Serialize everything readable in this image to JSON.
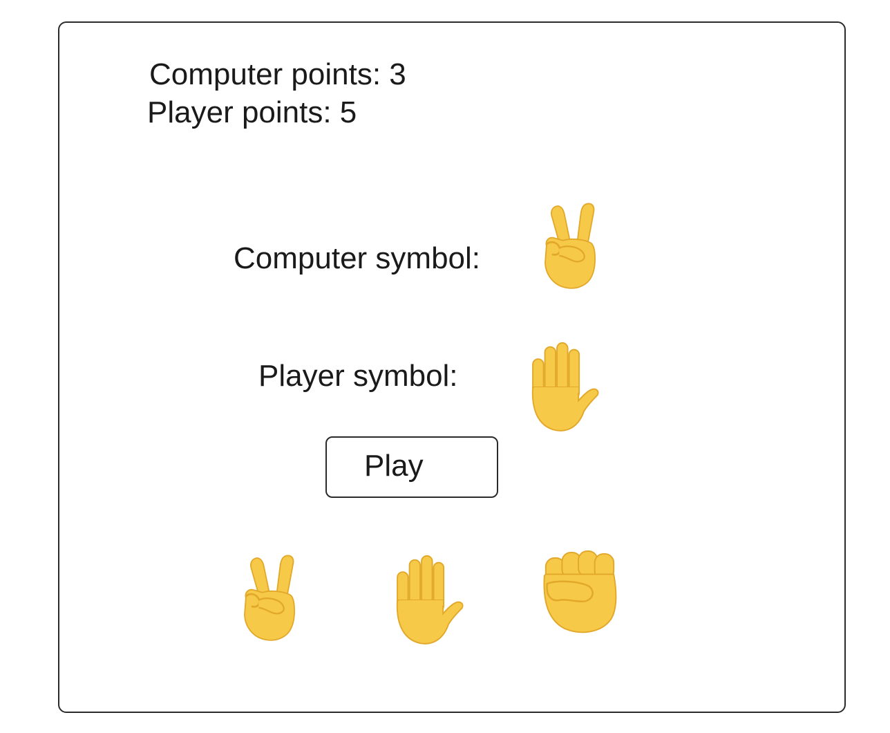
{
  "scores": {
    "computer_label": "Computer points: 3",
    "player_label": "Player points: 5"
  },
  "symbols": {
    "computer_label": "Computer symbol:",
    "computer_icon": "victory-hand-icon",
    "player_label": "Player symbol:",
    "player_icon": "raised-hand-icon"
  },
  "play_button": {
    "label": "Play"
  },
  "choices": [
    {
      "icon": "victory-hand-icon",
      "meaning": "scissors"
    },
    {
      "icon": "raised-hand-icon",
      "meaning": "paper"
    },
    {
      "icon": "raised-fist-icon",
      "meaning": "rock"
    }
  ],
  "colors": {
    "emoji_skin": "#F7C948",
    "emoji_shade": "#E2A82A",
    "border": "#2a2a2a"
  }
}
